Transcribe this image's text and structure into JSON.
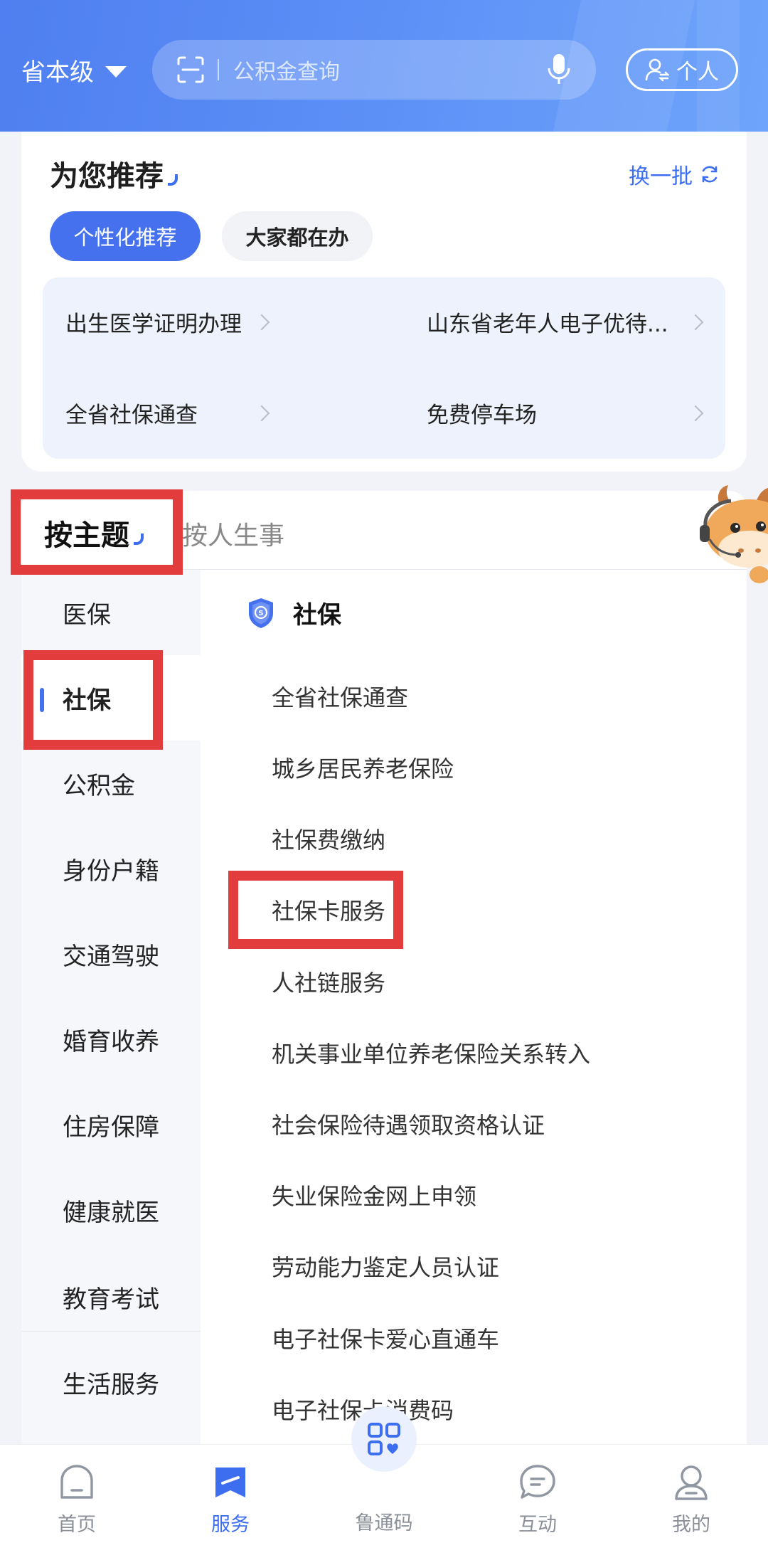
{
  "header": {
    "region": "省本级",
    "search_placeholder": "公积金查询",
    "profile_label": "个人",
    "icons": [
      "scan-icon",
      "mic-icon",
      "user-switch-icon",
      "chevron-down-icon"
    ]
  },
  "recommend": {
    "title": "为您推荐",
    "refresh_label": "换一批",
    "chips": [
      "个性化推荐",
      "大家都在办"
    ],
    "items": [
      "出生医学证明办理",
      "山东省老年人电子优待...",
      "全省社保通查",
      "免费停车场"
    ]
  },
  "theme": {
    "tabs": [
      "按主题",
      "按人生事"
    ],
    "categories": [
      "医保",
      "社保",
      "公积金",
      "身份户籍",
      "交通驾驶",
      "婚育收养",
      "住房保障",
      "健康就医",
      "教育考试",
      "生活服务"
    ],
    "active_category": "社保",
    "section_title": "社保",
    "services": [
      "全省社保通查",
      "城乡居民养老保险",
      "社保费缴纳",
      "社保卡服务",
      "人社链服务",
      "机关事业单位养老保险关系转入",
      "社会保险待遇领取资格认证",
      "失业保险金网上申领",
      "劳动能力鉴定人员认证",
      "电子社保卡爱心直通车",
      "电子社保卡消费码"
    ]
  },
  "bottom_nav": {
    "items": [
      "首页",
      "服务",
      "鲁通码",
      "互动",
      "我的"
    ],
    "active": "服务"
  },
  "colors": {
    "primary": "#4570ee",
    "header_gradient_start": "#4f7ff0",
    "header_gradient_end": "#6ea4fb",
    "annotation_red": "#e23c3c"
  }
}
